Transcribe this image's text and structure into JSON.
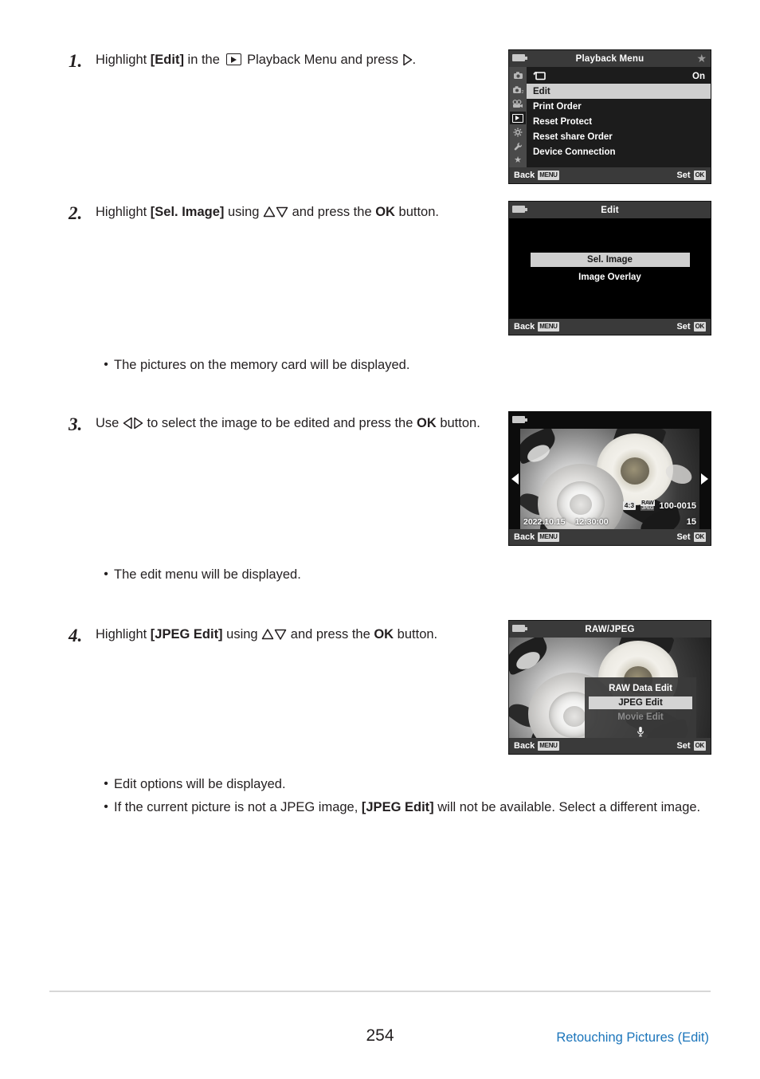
{
  "document": {
    "page_number": "254",
    "section_title": "Retouching Pictures (Edit)"
  },
  "steps": [
    {
      "number": "1.",
      "text_parts": {
        "a": "Highlight ",
        "b": "[Edit]",
        "c": " in the ",
        "d": " Playback Menu and press ",
        "e": "."
      }
    },
    {
      "number": "2.",
      "text_parts": {
        "a": "Highlight ",
        "b": "[Sel. Image]",
        "c": " using ",
        "d": " and press the ",
        "e": "OK",
        "f": " button."
      }
    },
    {
      "number": "3.",
      "text_parts": {
        "a": "Use ",
        "b": " to select the image to be edited and press the ",
        "c": "OK",
        "d": " button."
      }
    },
    {
      "number": "4.",
      "text_parts": {
        "a": "Highlight ",
        "b": "[JPEG Edit]",
        "c": " using ",
        "d": " and press the ",
        "e": "OK",
        "f": " button."
      }
    }
  ],
  "bullets": {
    "after_step2": "The pictures on the memory card will be displayed.",
    "after_step3": "The edit menu will be displayed.",
    "after_step4_1": "Edit options will be displayed.",
    "after_step4_2": {
      "a": "If the current picture is not a JPEG image, ",
      "b": "[JPEG Edit]",
      "c": " will not be available. Select a different image."
    }
  },
  "screens": {
    "playback_menu": {
      "title": "Playback Menu",
      "rail_icons": [
        "camera1-icon",
        "camera2-icon",
        "movie-camera-icon",
        "playback-icon",
        "gear-icon",
        "wrench-icon",
        "star-icon"
      ],
      "rows": [
        {
          "label": "",
          "icon": "slideshow-rotate-icon",
          "value": "On",
          "highlighted": false
        },
        {
          "label": "Edit",
          "value": "",
          "highlighted": true
        },
        {
          "label": "Print Order",
          "value": "",
          "highlighted": false
        },
        {
          "label": "Reset Protect",
          "value": "",
          "highlighted": false
        },
        {
          "label": "Reset share Order",
          "value": "",
          "highlighted": false
        },
        {
          "label": "Device Connection",
          "value": "",
          "highlighted": false
        }
      ],
      "footer_back": "Back",
      "footer_back_key": "MENU",
      "footer_set": "Set",
      "footer_set_key": "OK"
    },
    "edit": {
      "title": "Edit",
      "options": [
        {
          "label": "Sel. Image",
          "highlighted": true
        },
        {
          "label": "Image Overlay",
          "highlighted": false
        }
      ],
      "footer_back": "Back",
      "footer_back_key": "MENU",
      "footer_set": "Set",
      "footer_set_key": "OK"
    },
    "image_select": {
      "date": "2022.10.15",
      "time": "12:30:00",
      "aspect_ratio": "4:3",
      "quality_top": "RAW",
      "quality_bottom": "JPEG",
      "file_number": "100-0015",
      "frame_number": "15",
      "footer_back": "Back",
      "footer_back_key": "MENU",
      "footer_set": "Set",
      "footer_set_key": "OK"
    },
    "raw_jpeg": {
      "title": "RAW/JPEG",
      "items": [
        {
          "label": "RAW Data Edit",
          "highlighted": false,
          "disabled": false
        },
        {
          "label": "JPEG Edit",
          "highlighted": true,
          "disabled": false
        },
        {
          "label": "Movie Edit",
          "highlighted": false,
          "disabled": true
        }
      ],
      "mic_icon": "microphone-icon",
      "footer_back": "Back",
      "footer_back_key": "MENU",
      "footer_set": "Set",
      "footer_set_key": "OK"
    }
  },
  "colors": {
    "link_blue": "#1b75bb",
    "text_black": "#231f20",
    "lcd_highlight": "#cfcfcf",
    "lcd_chrome": "#3a3a3a"
  }
}
